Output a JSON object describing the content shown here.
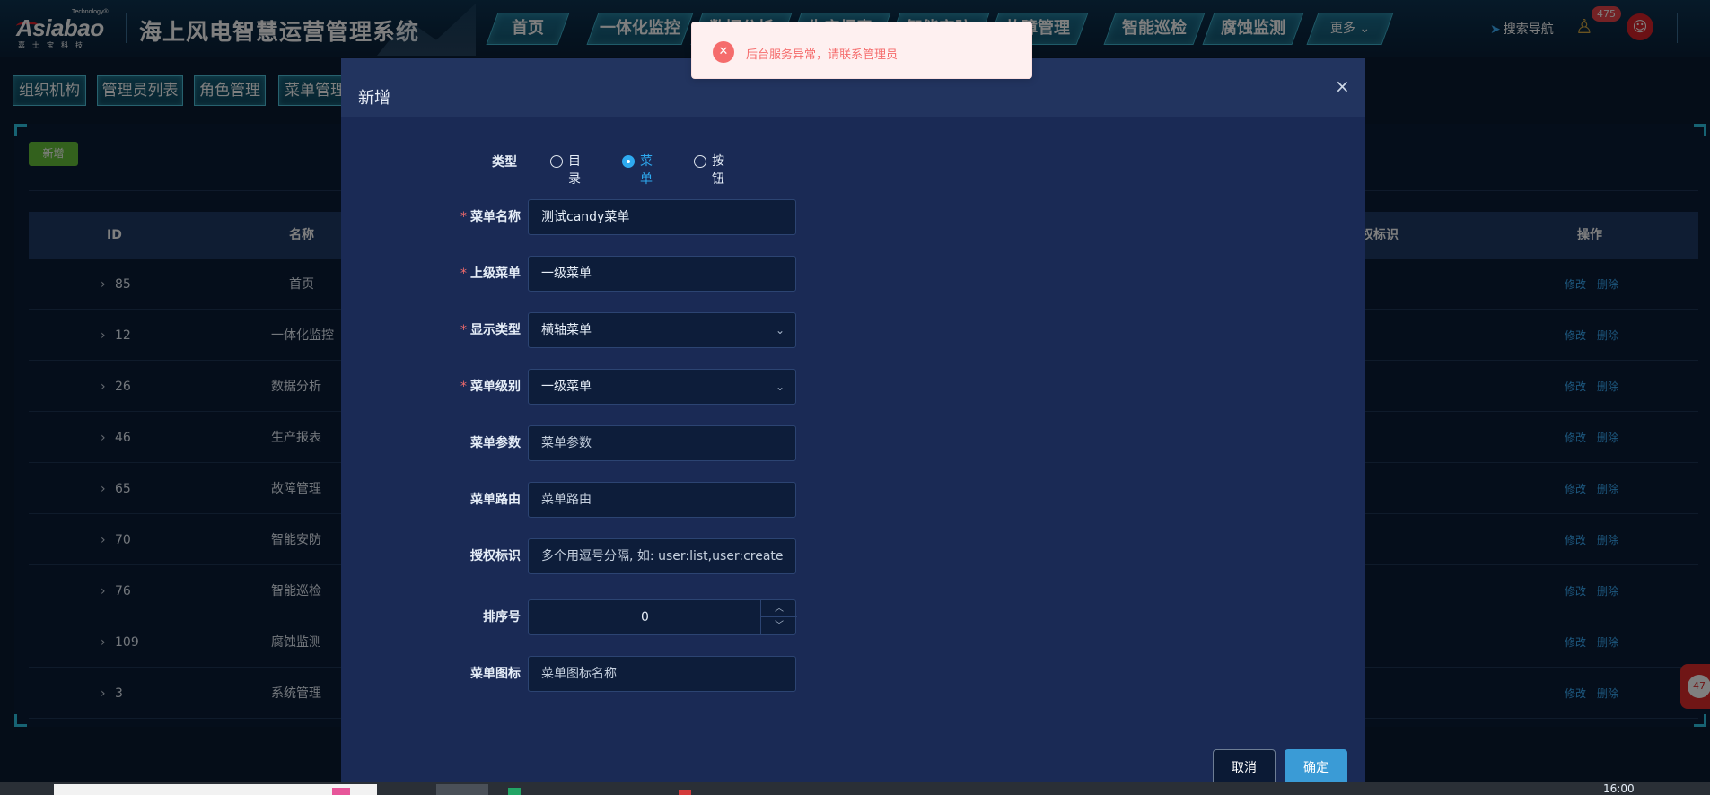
{
  "app": {
    "logo_text": "Asiabao",
    "logo_tm": "Technology®",
    "logo_sub": "嘉士宝科技",
    "title": "海上风电智慧运营管理系统"
  },
  "nav": {
    "items": [
      "首页",
      "一体化监控",
      "数据分析",
      "生产报表",
      "智能安防",
      "故障管理",
      "智能巡检",
      "腐蚀监测"
    ],
    "more": "更多 ⌄",
    "search_label": "搜索导航",
    "notification_count": "475"
  },
  "subtabs": [
    "组织机构",
    "管理员列表",
    "角色管理",
    "菜单管理"
  ],
  "toolbar": {
    "add_label": "新增"
  },
  "table": {
    "headers": {
      "id": "ID",
      "name": "名称",
      "auth": "授权标识",
      "op": "操作"
    },
    "rows": [
      {
        "id": "85",
        "name": "首页"
      },
      {
        "id": "12",
        "name": "一体化监控"
      },
      {
        "id": "26",
        "name": "数据分析"
      },
      {
        "id": "46",
        "name": "生产报表"
      },
      {
        "id": "65",
        "name": "故障管理"
      },
      {
        "id": "70",
        "name": "智能安防"
      },
      {
        "id": "76",
        "name": "智能巡检"
      },
      {
        "id": "109",
        "name": "腐蚀监测"
      },
      {
        "id": "3",
        "name": "系统管理"
      }
    ],
    "edit_label": "修改",
    "delete_label": "删除"
  },
  "float_badge": "47",
  "modal": {
    "title": "新增",
    "close_glyph": "×",
    "type_label": "类型",
    "type_options": [
      "目录",
      "菜单",
      "按钮"
    ],
    "type_selected": "菜单",
    "fields": {
      "menu_name": {
        "label": "菜单名称",
        "value": "测试candy菜单"
      },
      "parent_menu": {
        "label": "上级菜单",
        "value": "一级菜单"
      },
      "display_type": {
        "label": "显示类型",
        "value": "横轴菜单"
      },
      "menu_level": {
        "label": "菜单级别",
        "value": "一级菜单"
      },
      "menu_params": {
        "label": "菜单参数",
        "placeholder": "菜单参数"
      },
      "menu_route": {
        "label": "菜单路由",
        "placeholder": "菜单路由"
      },
      "auth_code": {
        "label": "授权标识",
        "placeholder": "多个用逗号分隔, 如: user:list,user:create"
      },
      "sort": {
        "label": "排序号",
        "value": "0"
      },
      "menu_icon": {
        "label": "菜单图标",
        "placeholder": "菜单图标名称"
      }
    },
    "cancel_label": "取消",
    "confirm_label": "确定"
  },
  "toast": {
    "message": "后台服务异常，请联系管理员"
  },
  "taskbar": {
    "time": "16:00"
  },
  "colors": {
    "accent": "#2eaaf0",
    "required": "#f56c6c",
    "add_button": "#67c23a",
    "confirm_button": "#3a9bd6",
    "error": "#f56c6c"
  }
}
